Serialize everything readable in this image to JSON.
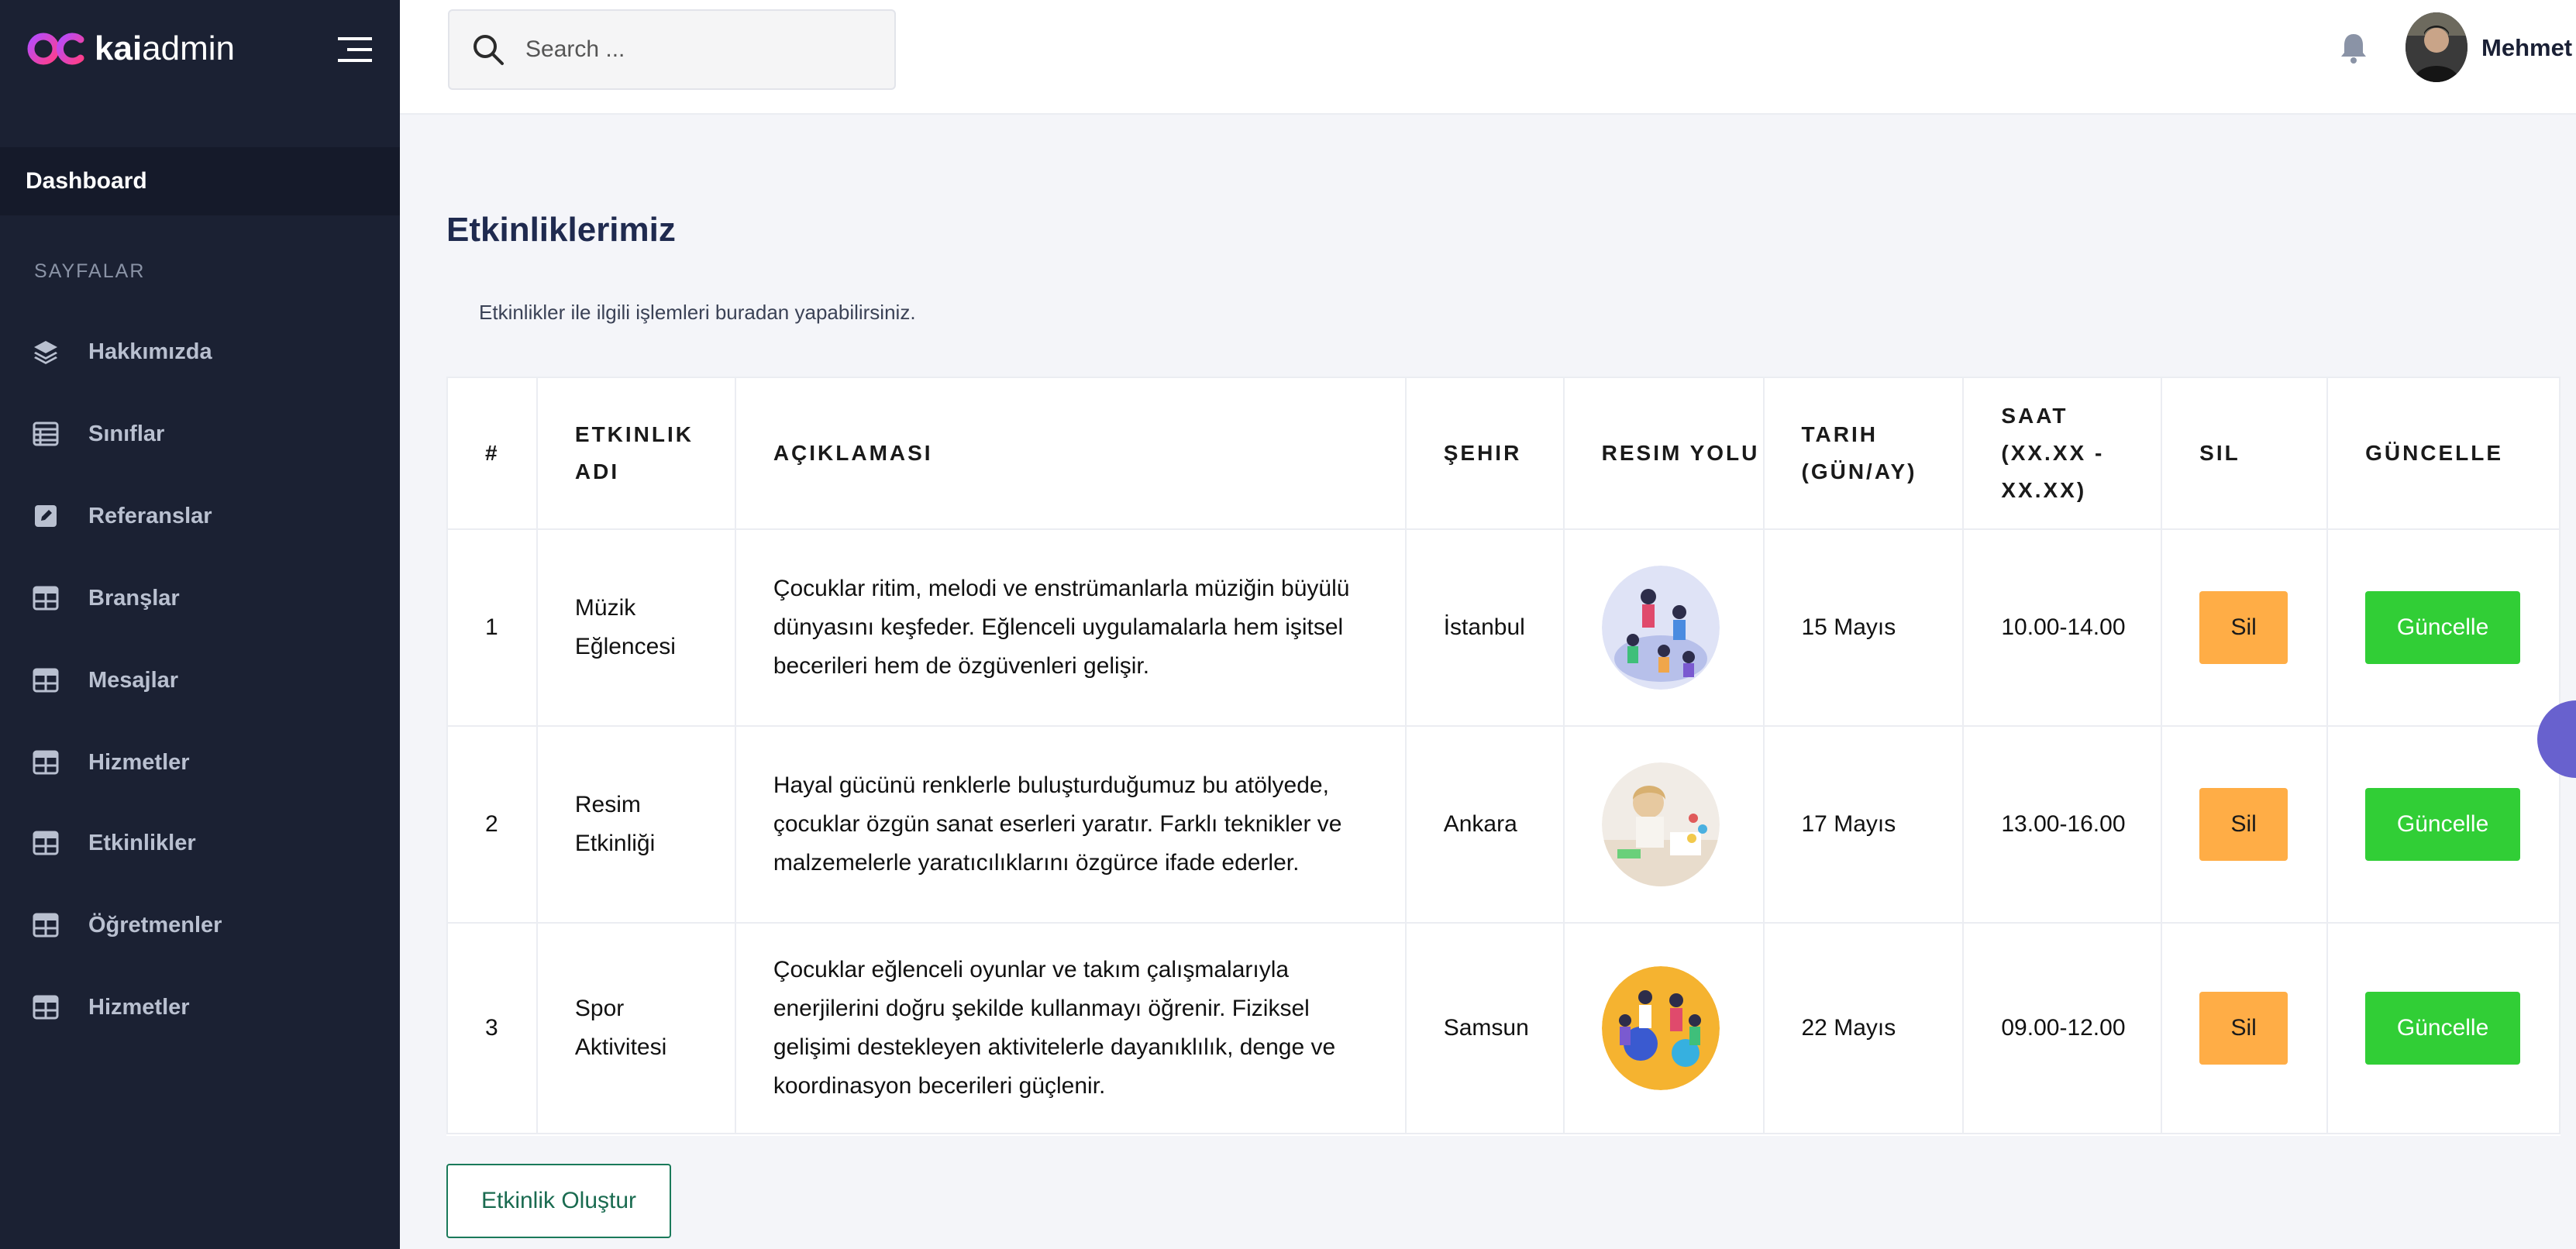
{
  "brand": {
    "name_bold": "kai",
    "name_light": "admin"
  },
  "sidebar": {
    "dashboard_label": "Dashboard",
    "section_title": "SAYFALAR",
    "items": [
      {
        "label": "Hakkımızda",
        "icon": "layers-icon"
      },
      {
        "label": "Sınıflar",
        "icon": "table-list-icon"
      },
      {
        "label": "Referanslar",
        "icon": "edit-square-icon"
      },
      {
        "label": "Branşlar",
        "icon": "grid-table-icon"
      },
      {
        "label": "Mesajlar",
        "icon": "grid-table-icon"
      },
      {
        "label": "Hizmetler",
        "icon": "grid-table-icon"
      },
      {
        "label": "Etkinlikler",
        "icon": "grid-table-icon"
      },
      {
        "label": "Öğretmenler",
        "icon": "grid-table-icon"
      },
      {
        "label": "Hizmetler",
        "icon": "grid-table-icon"
      }
    ]
  },
  "header": {
    "search_placeholder": "Search ...",
    "user_name": "Mehmet"
  },
  "main": {
    "title": "Etkinliklerimiz",
    "subtitle": "Etkinlikler ile ilgili işlemleri buradan yapabilirsiniz.",
    "columns": [
      "#",
      "ETKINLIK ADI",
      "AÇIKLAMASI",
      "ŞEHIR",
      "RESIM YOLU",
      "TARIH (GÜN/AY)",
      "SAAT (XX.XX - XX.XX)",
      "SIL",
      "GÜNCELLE"
    ],
    "rows": [
      {
        "num": "1",
        "name": "Müzik Eğlencesi",
        "desc": "Çocuklar ritim, melodi ve enstrümanlarla müziğin büyülü dünyasını keşfeder. Eğlenceli uygulamalarla hem işitsel becerileri hem de özgüvenleri gelişir.",
        "city": "İstanbul",
        "date": "15 Mayıs",
        "time": "10.00-14.00",
        "delete_label": "Sil",
        "update_label": "Güncelle"
      },
      {
        "num": "2",
        "name": "Resim Etkinliği",
        "desc": "Hayal gücünü renklerle buluşturduğumuz bu atölyede, çocuklar özgün sanat eserleri yaratır. Farklı teknikler ve malzemelerle yaratıcılıklarını özgürce ifade ederler.",
        "city": "Ankara",
        "date": "17 Mayıs",
        "time": "13.00-16.00",
        "delete_label": "Sil",
        "update_label": "Güncelle"
      },
      {
        "num": "3",
        "name": "Spor Aktivitesi",
        "desc": "Çocuklar eğlenceli oyunlar ve takım çalışmalarıyla enerjilerini doğru şekilde kullanmayı öğrenir. Fiziksel gelişimi destekleyen aktivitelerle dayanıklılık, denge ve koordinasyon becerileri güçlenir.",
        "city": "Samsun",
        "date": "22 Mayıs",
        "time": "09.00-12.00",
        "delete_label": "Sil",
        "update_label": "Güncelle"
      }
    ],
    "create_label": "Etkinlik Oluştur"
  },
  "colors": {
    "sidebar_bg": "#1b2133",
    "delete_button": "#ffad46",
    "update_button": "#31ce36",
    "accent_fab": "#6861ce"
  }
}
